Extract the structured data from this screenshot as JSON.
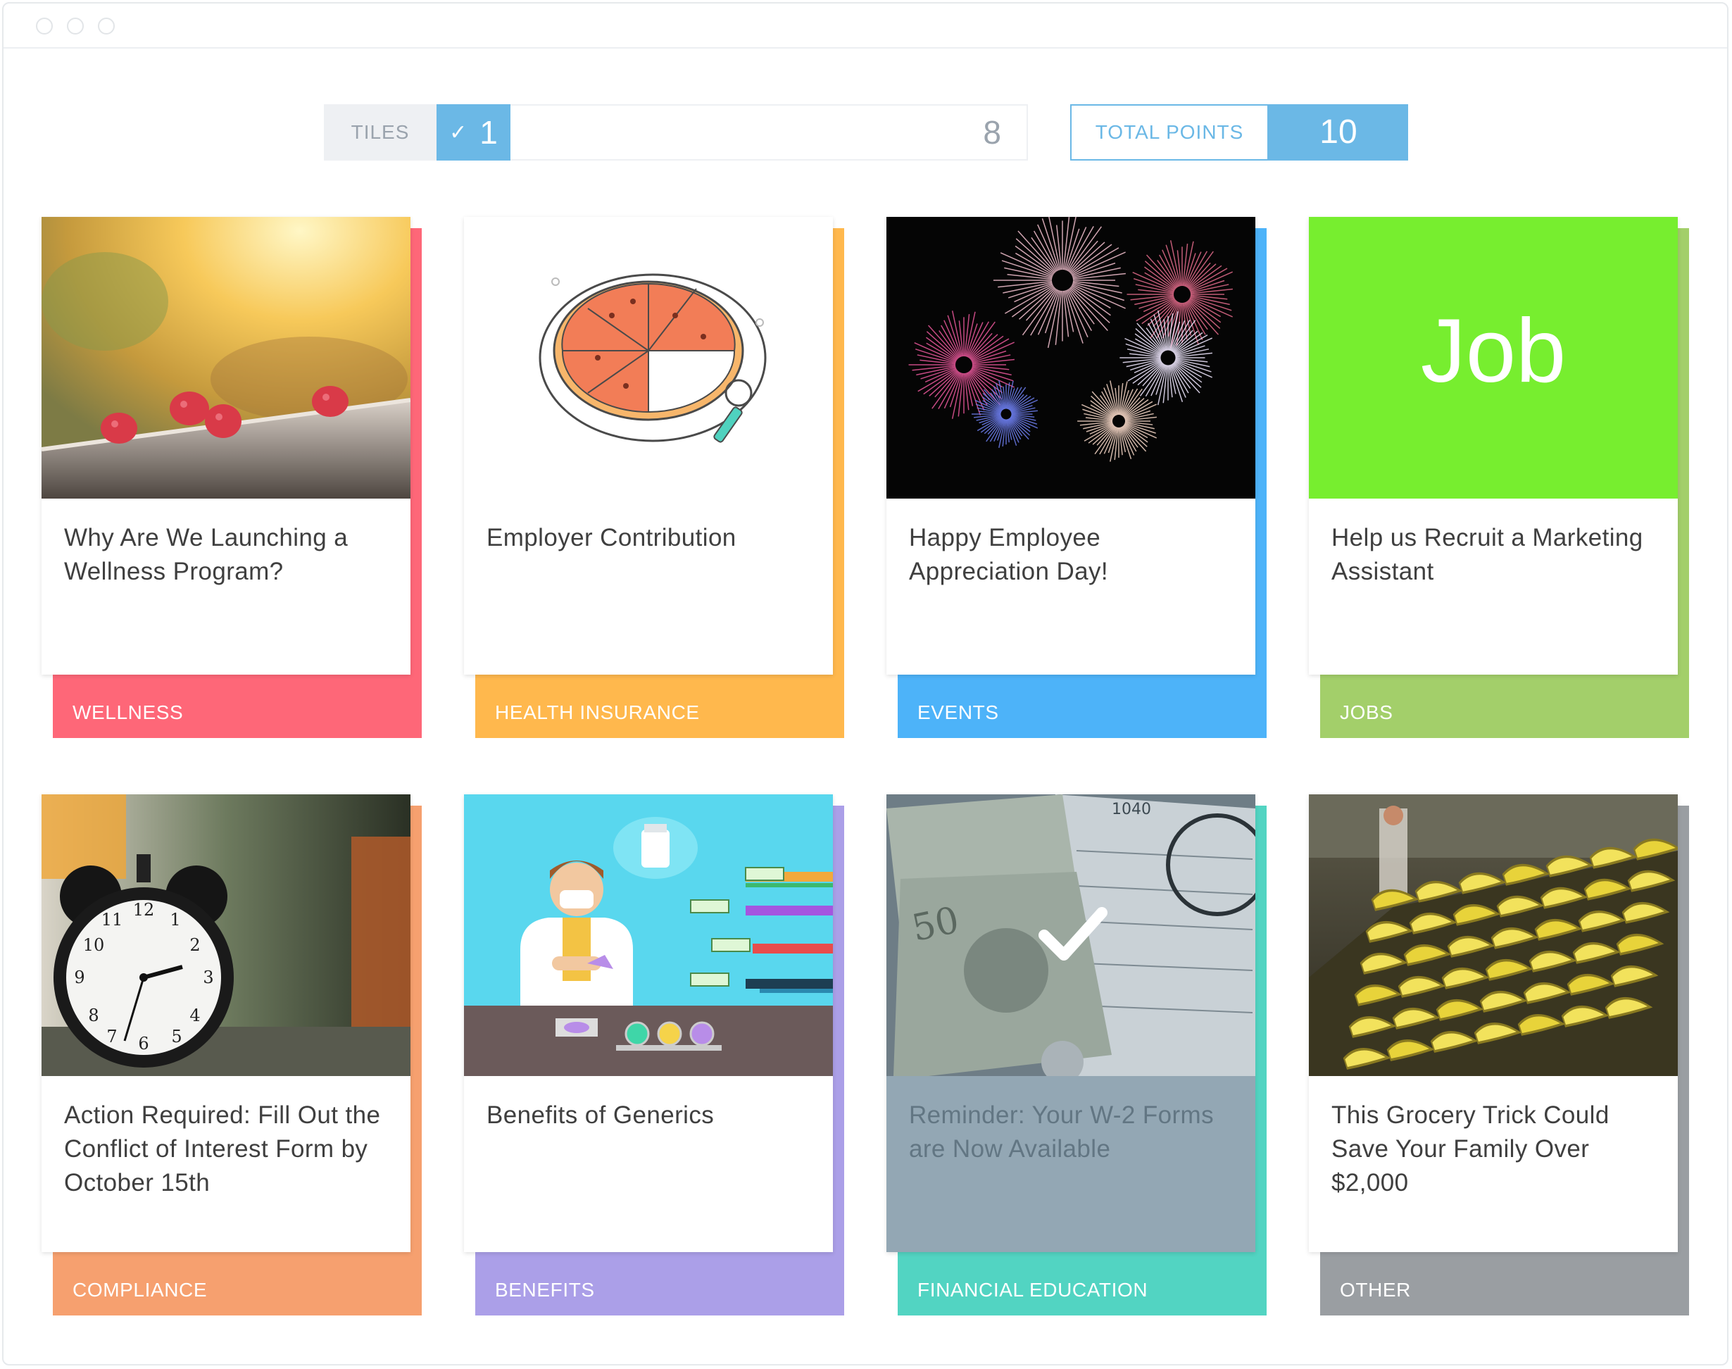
{
  "progress": {
    "tiles_label": "TILES",
    "completed_count": "1",
    "total_count": "8",
    "completed_fraction": 0.125,
    "points_label": "TOTAL POINTS",
    "points_value": "10"
  },
  "tiles": [
    {
      "title": "Why Are We Launching a Wellness Program?",
      "category": "WELLNESS",
      "color": "#fe6778",
      "image": "raspberries"
    },
    {
      "title": "Employer Contribution",
      "category": "HEALTH INSURANCE",
      "color": "#ffb84d",
      "image": "pizza-pie-chart"
    },
    {
      "title": "Happy Employee Appreciation Day!",
      "category": "EVENTS",
      "color": "#4db3f9",
      "image": "fireworks"
    },
    {
      "title": "Help us Recruit a Marketing Assistant",
      "category": "JOBS",
      "color": "#a3cf6a",
      "image": "job-sign",
      "image_text": "Job",
      "image_bg": "#77ee2f"
    },
    {
      "title": "Action Required: Fill Out the Conflict of Interest Form by October 15th",
      "category": "COMPLIANCE",
      "color": "#f6a06f",
      "image": "alarm-clock"
    },
    {
      "title": "Benefits of Generics",
      "category": "BENEFITS",
      "color": "#ab9fe8",
      "image": "pharmacist"
    },
    {
      "title": "Reminder: Your W-2 Forms are Now Available",
      "category": "FINANCIAL EDUCATION",
      "color": "#52d4c2",
      "image": "money-tax-forms",
      "completed": true
    },
    {
      "title": "This Grocery Trick Could Save Your Family Over $2,000",
      "category": "OTHER",
      "color": "#9a9ea2",
      "image": "bananas"
    }
  ]
}
